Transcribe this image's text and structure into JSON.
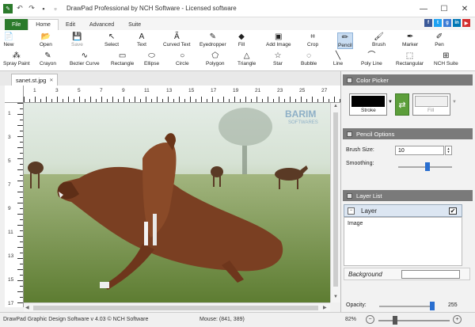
{
  "window": {
    "title": "DrawPad Professional by NCH Software - Licensed software",
    "controls": {
      "minimize": "—",
      "maximize": "☐",
      "close": "✕"
    }
  },
  "ribbon_tabs": [
    {
      "label": "File"
    },
    {
      "label": "Home"
    },
    {
      "label": "Edit"
    },
    {
      "label": "Advanced"
    },
    {
      "label": "Suite"
    }
  ],
  "social": [
    {
      "glyph": "f",
      "color": "#3b5998"
    },
    {
      "glyph": "t",
      "color": "#1da1f2"
    },
    {
      "glyph": "g",
      "color": "#3a7bd5"
    },
    {
      "glyph": "in",
      "color": "#0077b5"
    },
    {
      "glyph": "▶",
      "color": "#d32f2f"
    }
  ],
  "ribbon": {
    "row1": [
      {
        "label": "New",
        "icon": "📄"
      },
      {
        "label": "Open",
        "icon": "📂"
      },
      {
        "label": "Save",
        "icon": "💾"
      },
      {
        "label": "Select",
        "icon": "↖"
      },
      {
        "label": "Text",
        "icon": "A"
      },
      {
        "label": "Curved Text",
        "icon": "Ã"
      },
      {
        "label": "Eyedropper",
        "icon": "✎"
      },
      {
        "label": "Fill",
        "icon": "◆"
      },
      {
        "label": "Add Image",
        "icon": "▣"
      },
      {
        "label": "Crop",
        "icon": "⌗"
      },
      {
        "label": "Pencil",
        "icon": "✏"
      },
      {
        "label": "Brush",
        "icon": "🖌"
      },
      {
        "label": "Marker",
        "icon": "✒"
      },
      {
        "label": "Pen",
        "icon": "✐"
      }
    ],
    "row2": [
      {
        "label": "Spray Paint",
        "icon": "⁂"
      },
      {
        "label": "Crayon",
        "icon": "✎"
      },
      {
        "label": "Bezier Curve",
        "icon": "∿"
      },
      {
        "label": "Rectangle",
        "icon": "▭"
      },
      {
        "label": "Ellipse",
        "icon": "⬭"
      },
      {
        "label": "Circle",
        "icon": "○"
      },
      {
        "label": "Polygon",
        "icon": "⬠"
      },
      {
        "label": "Triangle",
        "icon": "△"
      },
      {
        "label": "Star",
        "icon": "☆"
      },
      {
        "label": "Bubble",
        "icon": "◌"
      },
      {
        "label": "Line",
        "icon": "╲"
      },
      {
        "label": "Poly Line",
        "icon": "⌒"
      },
      {
        "label": "Rectangular",
        "icon": "⬚"
      },
      {
        "label": "NCH Suite",
        "icon": "⊞"
      }
    ]
  },
  "document": {
    "tab_label": "sanet.st.jpg",
    "close": "✕"
  },
  "ruler": {
    "h_labels": [
      "1",
      "3",
      "5",
      "7",
      "9",
      "11",
      "13",
      "15",
      "17",
      "19",
      "21",
      "23",
      "25",
      "27"
    ],
    "v_labels": [
      "1",
      "3",
      "5",
      "7",
      "9",
      "11",
      "13",
      "15",
      "17"
    ]
  },
  "panel": {
    "color_picker": {
      "title": "Color Picker",
      "stroke_label": "Stroke",
      "fill_label": "Fill",
      "stroke_color": "#000000",
      "fill_color": "#f0f0f0"
    },
    "pencil_options": {
      "title": "Pencil Options",
      "brush_size_label": "Brush Size:",
      "brush_size_value": "10",
      "smoothing_label": "Smoothing:",
      "smoothing_level": 0.55
    },
    "layer_list": {
      "title": "Layer List",
      "layer_name": "Layer",
      "layer_item": "Image",
      "background_label": "Background"
    },
    "opacity": {
      "label": "Opacity:",
      "value": "255",
      "level": 1.0
    }
  },
  "watermark": {
    "line1": "BARIM",
    "line2": "SOFTWARES"
  },
  "status": {
    "version": "DrawPad Graphic Design Software v 4.03 © NCH Software",
    "mouse": "Mouse: (841, 389)",
    "zoom": "82%"
  },
  "colors": {
    "accent_green": "#2b7a2b",
    "panel_header": "#7a7a7a",
    "selected_tool": "#c9ddf2"
  }
}
